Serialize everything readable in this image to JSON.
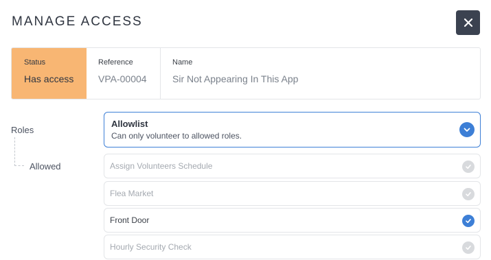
{
  "dialog": {
    "title": "MANAGE ACCESS",
    "close_icon": "close-icon"
  },
  "info": {
    "status_label": "Status",
    "status_value": "Has access",
    "reference_label": "Reference",
    "reference_value": "VPA-00004",
    "name_label": "Name",
    "name_value": "Sir Not Appearing In This App"
  },
  "roles": {
    "label": "Roles",
    "allowed_label": "Allowed",
    "mode": {
      "title": "Allowlist",
      "description": "Can only volunteer to allowed roles.",
      "icon": "chevron-down-icon"
    },
    "items": [
      {
        "label": "Assign Volunteers Schedule",
        "checked": false
      },
      {
        "label": "Flea Market",
        "checked": false
      },
      {
        "label": "Front Door",
        "checked": true
      },
      {
        "label": "Hourly Security Check",
        "checked": false
      }
    ]
  },
  "colors": {
    "accent": "#3d7fd6",
    "status_bg": "#f8b673",
    "close_bg": "#3b4250"
  }
}
